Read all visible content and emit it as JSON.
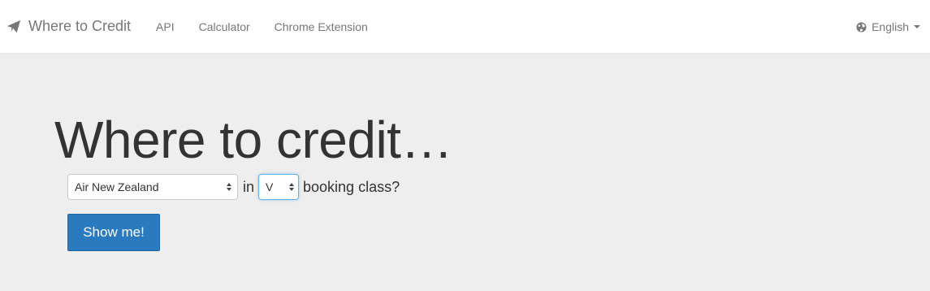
{
  "navbar": {
    "brand": "Where to Credit",
    "brand_icon": "paper-plane-icon",
    "links": [
      "API",
      "Calculator",
      "Chrome Extension"
    ],
    "language": "English",
    "language_icon": "globe-icon"
  },
  "main": {
    "heading": "Where to credit…",
    "airline_select": {
      "value": "Air New Zealand"
    },
    "in_text": "in",
    "class_select": {
      "value": "V"
    },
    "booking_text": "booking class?",
    "submit_label": "Show me!"
  },
  "colors": {
    "navbar_bg": "#ffffff",
    "page_bg": "#eeeeee",
    "button_bg": "#2a7ac0",
    "focus_border": "#66afe9"
  }
}
